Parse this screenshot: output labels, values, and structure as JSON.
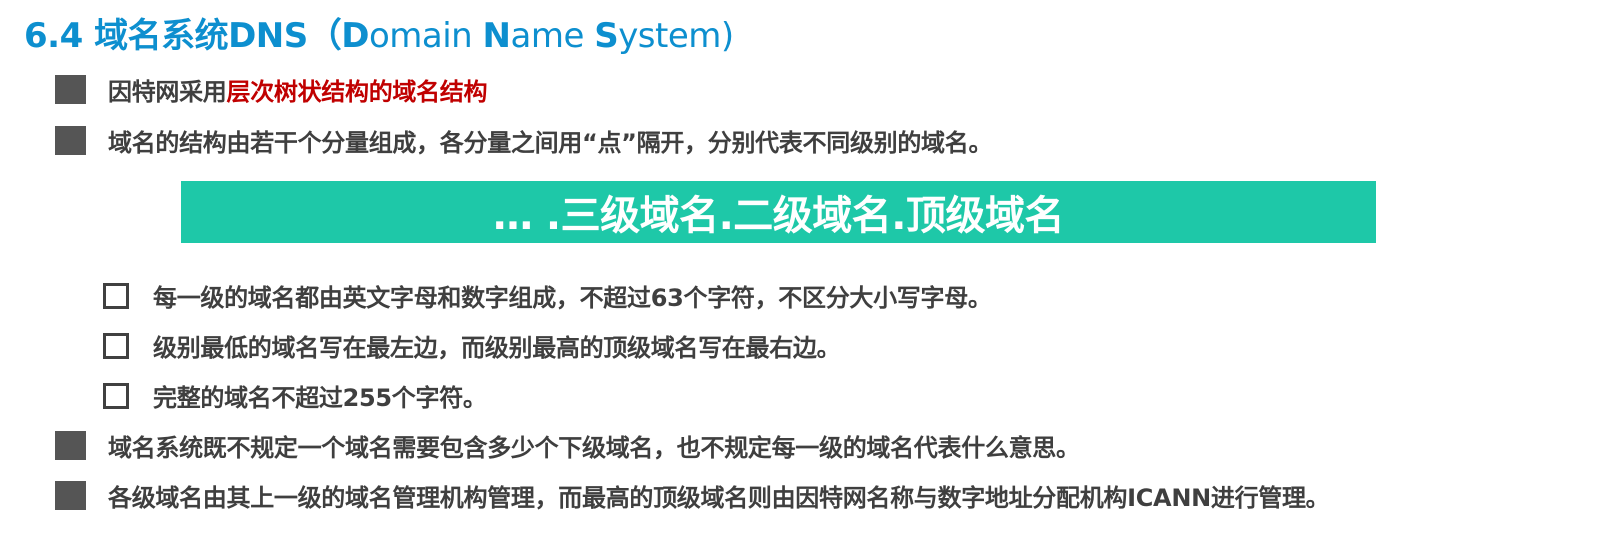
{
  "title": {
    "prefix": "6.4 域名系统DNS（",
    "d": "D",
    "omain": "omain ",
    "n": "N",
    "ame": "ame ",
    "s": "S",
    "ystem": "ystem)"
  },
  "bullets": [
    {
      "text": "因特网采用",
      "highlight": "层次树状结构的域名结构"
    },
    {
      "text": "域名的结构由若干个分量组成，各分量之间用“点”隔开，分别代表不同级别的域名。"
    }
  ],
  "banner": {
    "text": "…  .三级域名.二级域名.顶级域名"
  },
  "sub_items": [
    "每一级的域名都由英文字母和数字组成，不超过63个字符，不区分大小写字母。",
    "级别最低的域名写在最左边，而级别最高的顶级域名写在最右边。",
    "完整的域名不超过255个字符。"
  ],
  "bullets_after": [
    "域名系统既不规定一个域名需要包含多少个下级域名，也不规定每一级的域名代表什么意思。",
    "各级域名由其上一级的域名管理机构管理，而最高的顶级域名则由因特网名称与数字地址分配机构ICANN进行管理。"
  ],
  "colors": {
    "title": "#0d8fcf",
    "highlight": "#c00000",
    "banner": "#1ec8a8",
    "text": "#3f3f3f"
  }
}
